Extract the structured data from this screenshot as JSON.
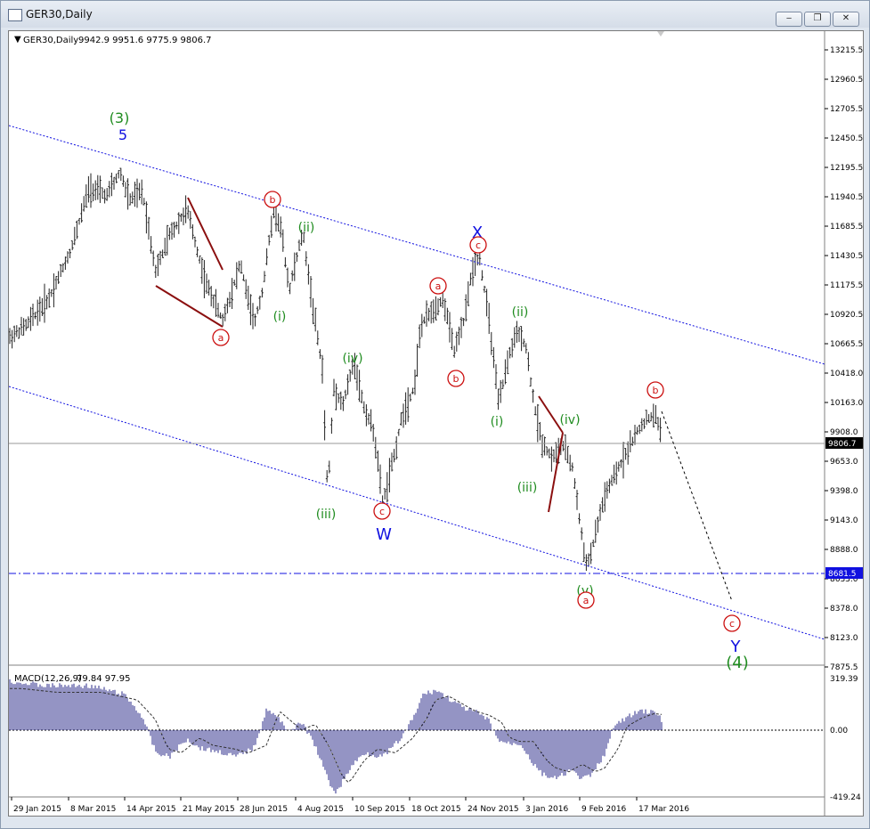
{
  "window": {
    "title": "GER30,Daily",
    "minimize_glyph": "‒",
    "restore_glyph": "❐",
    "close_glyph": "✕"
  },
  "chart": {
    "symbol_header": "GER30,Daily",
    "ohlc": "9942.9 9951.6 9775.9 9806.7",
    "current_price": "9806.7",
    "level_line": "8681.5",
    "price_ticks": [
      "13215.5",
      "12960.5",
      "12705.5",
      "12450.5",
      "12195.5",
      "11940.5",
      "11685.5",
      "11430.5",
      "11175.5",
      "10920.5",
      "10665.5",
      "10418.0",
      "10163.0",
      "9908.0",
      "9653.0",
      "9398.0",
      "9143.0",
      "8888.0",
      "8633.0",
      "8378.0",
      "8123.0",
      "7875.5"
    ],
    "macd_label": "MACD(12,26,9)",
    "macd_values": "79.84 97.95",
    "macd_ticks": [
      "319.39",
      "0.00",
      "-419.24"
    ],
    "date_ticks": [
      "29 Jan 2015",
      "8 Mar 2015",
      "14 Apr 2015",
      "21 May 2015",
      "28 Jun 2015",
      "4 Aug 2015",
      "10 Sep 2015",
      "18 Oct 2015",
      "24 Nov 2015",
      "3 Jan 2016",
      "9 Feb 2016",
      "17 Mar 2016"
    ],
    "wave_labels": [
      {
        "text": "(3)",
        "color": "#1f8c1f"
      },
      {
        "text": "5",
        "color": "#1010e0"
      },
      {
        "text": "a",
        "color": "#cc1111",
        "circled": true
      },
      {
        "text": "b",
        "color": "#cc1111",
        "circled": true
      },
      {
        "text": "(i)",
        "color": "#1f8c1f"
      },
      {
        "text": "(ii)",
        "color": "#1f8c1f"
      },
      {
        "text": "(iii)",
        "color": "#1f8c1f"
      },
      {
        "text": "(iv)",
        "color": "#1f8c1f"
      },
      {
        "text": "c",
        "color": "#cc1111",
        "circled": true
      },
      {
        "text": "W",
        "color": "#1010e0"
      },
      {
        "text": "a",
        "color": "#cc1111",
        "circled": true
      },
      {
        "text": "b",
        "color": "#cc1111",
        "circled": true
      },
      {
        "text": "X",
        "color": "#1010e0"
      },
      {
        "text": "c",
        "color": "#cc1111",
        "circled": true
      },
      {
        "text": "(i)",
        "color": "#1f8c1f"
      },
      {
        "text": "(ii)",
        "color": "#1f8c1f"
      },
      {
        "text": "(iii)",
        "color": "#1f8c1f"
      },
      {
        "text": "(iv)",
        "color": "#1f8c1f"
      },
      {
        "text": "(v)",
        "color": "#1f8c1f"
      },
      {
        "text": "a",
        "color": "#cc1111",
        "circled": true
      },
      {
        "text": "b",
        "color": "#cc1111",
        "circled": true
      },
      {
        "text": "c",
        "color": "#cc1111",
        "circled": true
      },
      {
        "text": "Y",
        "color": "#1010e0"
      },
      {
        "text": "(4)",
        "color": "#1f8c1f"
      }
    ],
    "colors": {
      "price_bar": "#222222",
      "channel_line": "#1010e0",
      "level_line": "#1010e0",
      "current_line": "#9a9a9a",
      "wedge_line": "#8b0f0f",
      "macd_hist": "#2a2a8a",
      "macd_signal": "#333333",
      "up_wave": "#1f8c1f",
      "abc_wave": "#cc1111",
      "wxy_wave": "#1010e0",
      "price_tag_bg": "#000000",
      "level_tag_bg": "#1010e0"
    }
  }
}
